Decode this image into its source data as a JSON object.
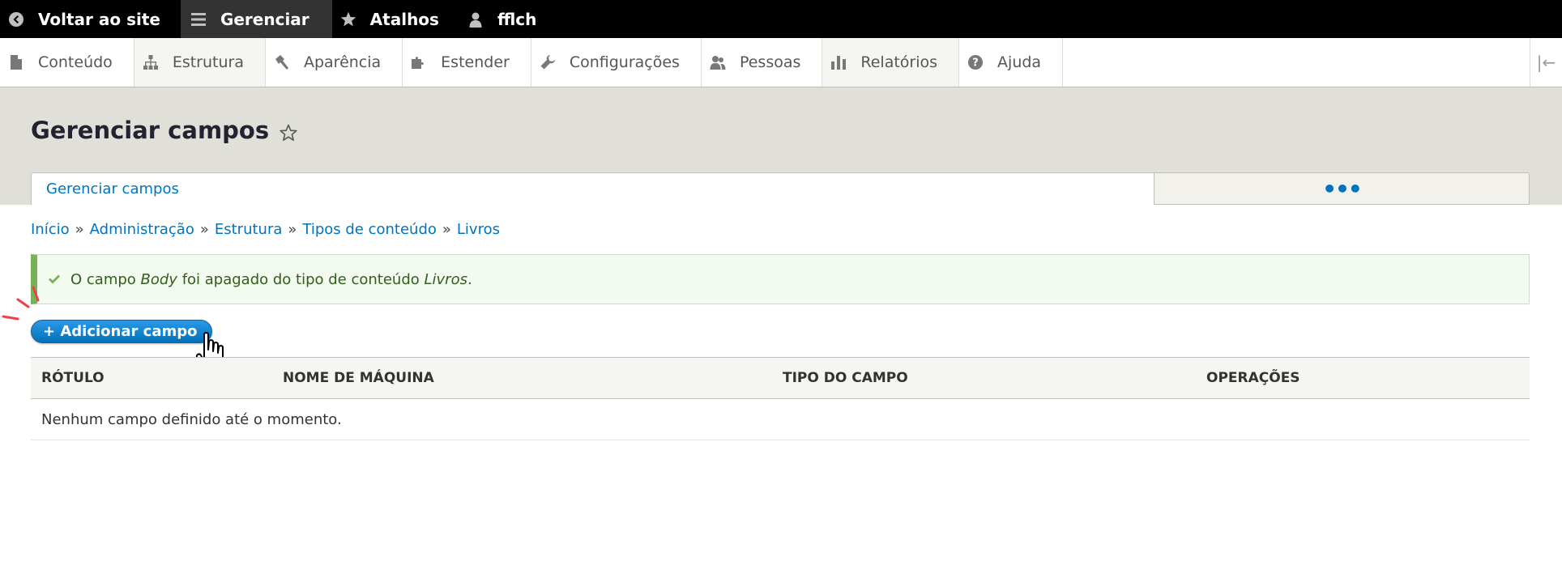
{
  "toolbar": {
    "items": [
      {
        "label": "Voltar ao site",
        "icon": "chevron-left-circle-icon"
      },
      {
        "label": "Gerenciar",
        "icon": "hamburger-menu-icon"
      },
      {
        "label": "Atalhos",
        "icon": "star-icon"
      },
      {
        "label": "fflch",
        "icon": "user-icon"
      }
    ]
  },
  "tray": {
    "items": [
      {
        "label": "Conteúdo",
        "icon": "file-icon"
      },
      {
        "label": "Estrutura",
        "icon": "sitemap-icon"
      },
      {
        "label": "Aparência",
        "icon": "paintbrush-icon"
      },
      {
        "label": "Estender",
        "icon": "puzzle-icon"
      },
      {
        "label": "Configurações",
        "icon": "wrench-icon"
      },
      {
        "label": "Pessoas",
        "icon": "people-icon"
      },
      {
        "label": "Relatórios",
        "icon": "bar-chart-icon"
      },
      {
        "label": "Ajuda",
        "icon": "help-icon"
      }
    ],
    "collapse_glyph": "|←"
  },
  "header": {
    "title": "Gerenciar campos",
    "tab_primary": "Gerenciar campos",
    "tab_more": "•••"
  },
  "breadcrumb": {
    "items": [
      "Início",
      "Administração",
      "Estrutura",
      "Tipos de conteúdo",
      "Livros"
    ],
    "separator": "»"
  },
  "status": {
    "prefix": "O campo ",
    "field": "Body",
    "middle": " foi apagado do tipo de conteúdo ",
    "type": "Livros",
    "suffix": "."
  },
  "add_button": {
    "label": "+ Adicionar campo"
  },
  "table": {
    "headers": [
      "Rótulo",
      "Nome de máquina",
      "Tipo do campo",
      "Operações"
    ],
    "empty_message": "Nenhum campo definido até o momento."
  },
  "colors": {
    "link": "#0074bd",
    "header_bg": "#e0e0d8",
    "status_border": "#77b259",
    "button": "#1f8fe6"
  }
}
